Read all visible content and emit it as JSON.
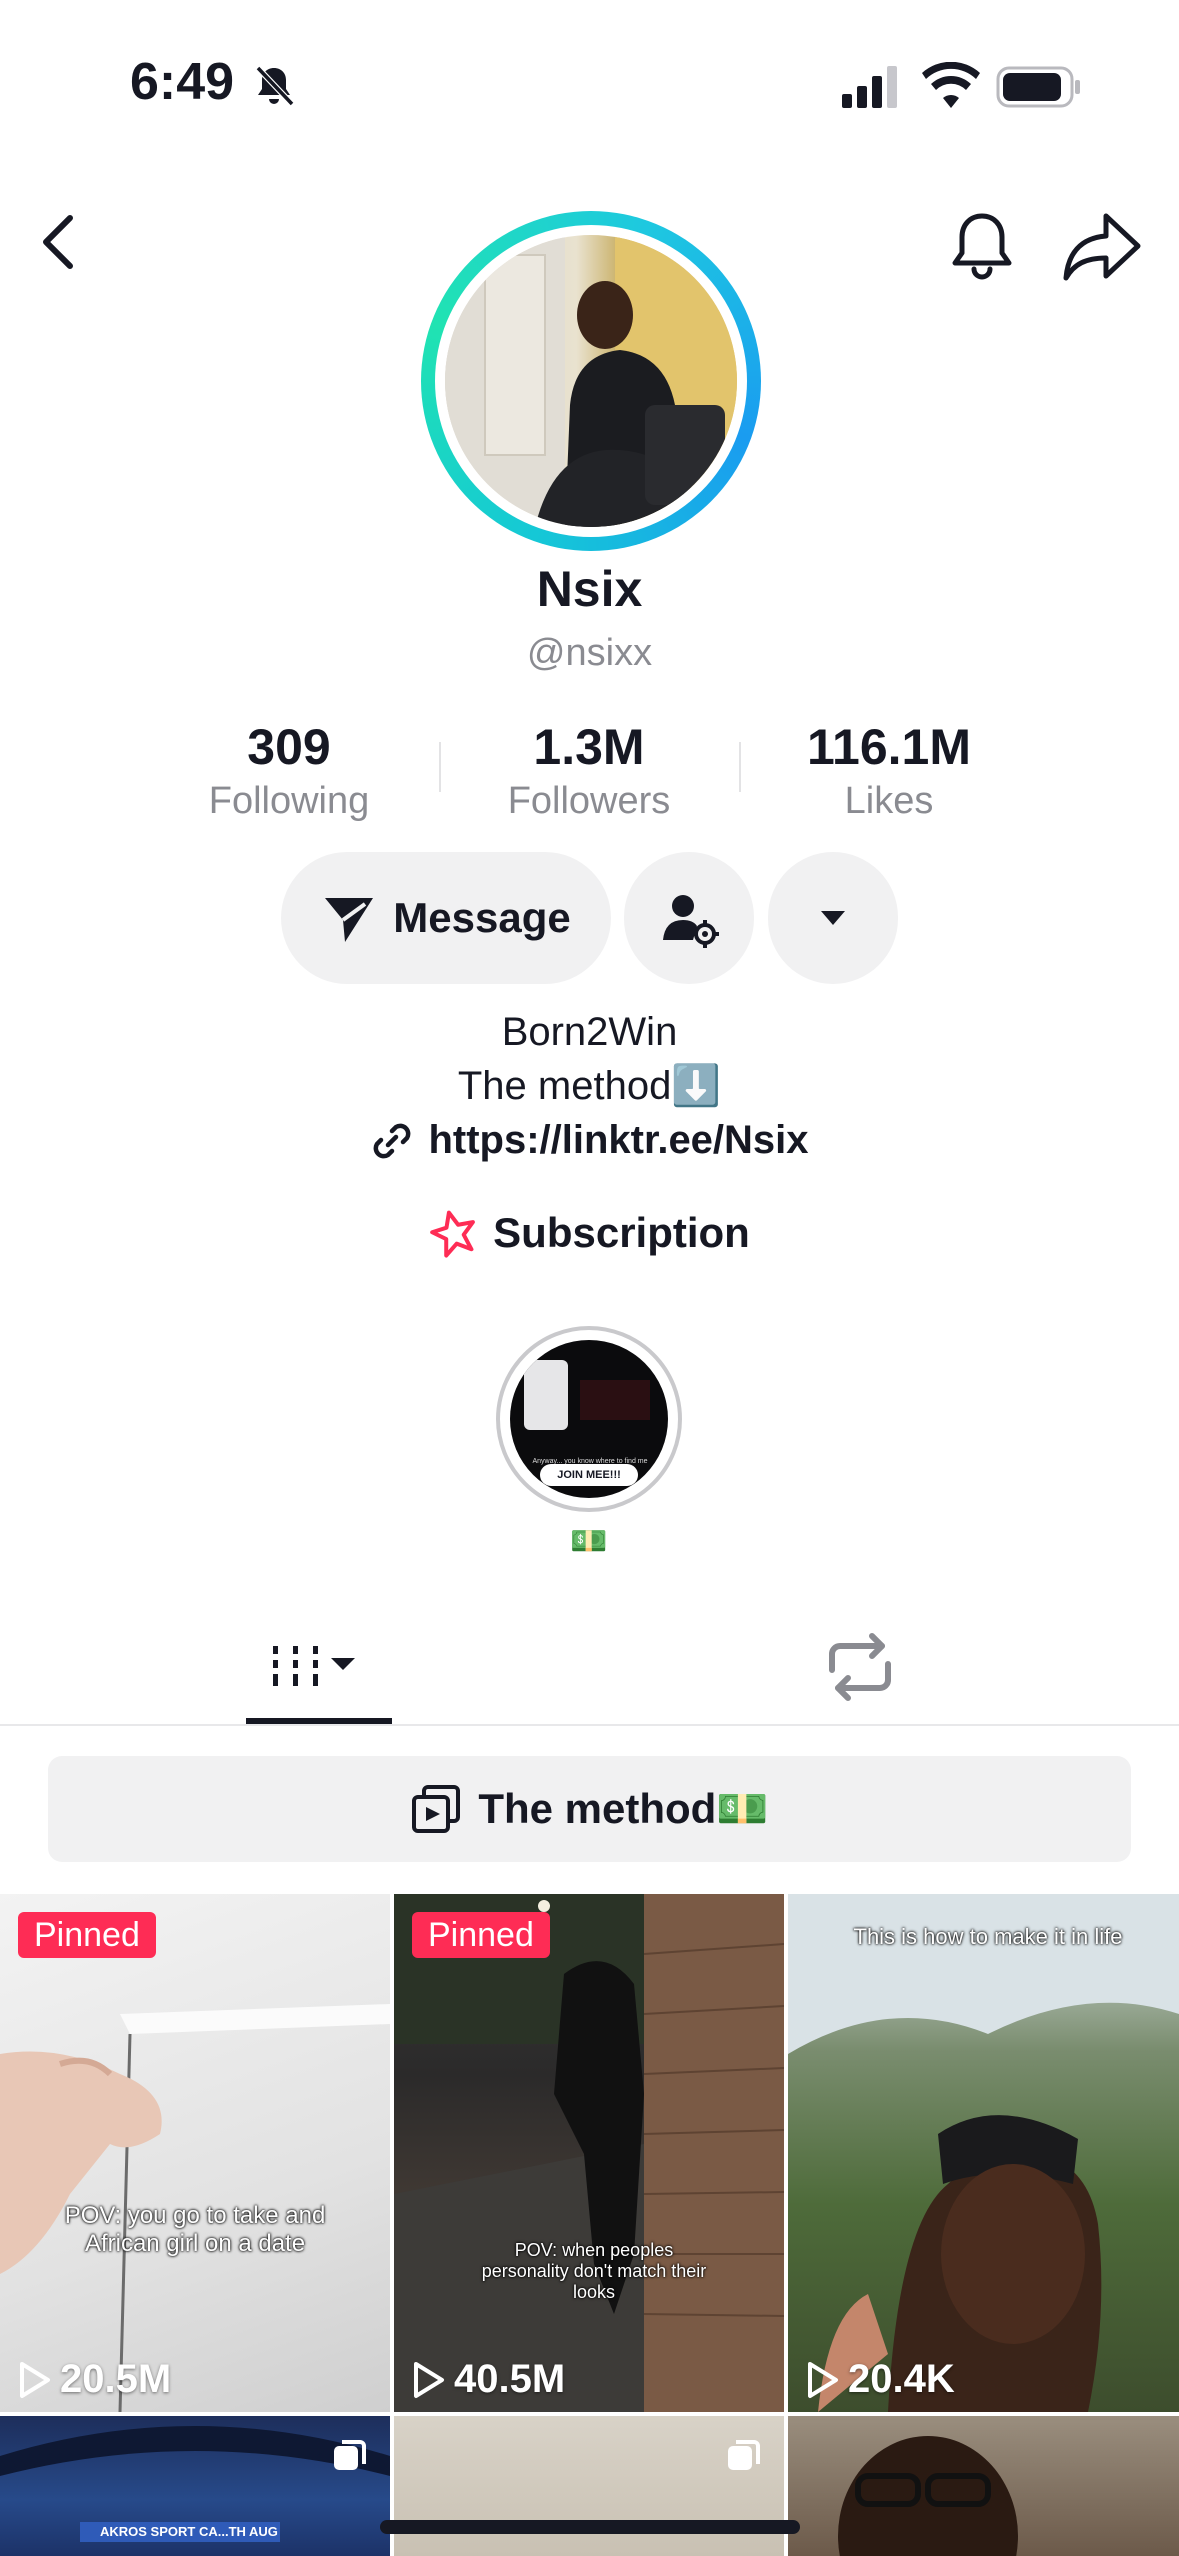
{
  "status_bar": {
    "time": "6:49"
  },
  "profile": {
    "display_name": "Nsix",
    "username": "@nsixx",
    "stats": [
      {
        "value": "309",
        "label": "Following"
      },
      {
        "value": "1.3M",
        "label": "Followers"
      },
      {
        "value": "116.1M",
        "label": "Likes"
      }
    ],
    "message_label": "Message",
    "bio_line1": "Born2Win",
    "bio_line2": "The method⬇️",
    "link": "https://linktr.ee/Nsix",
    "subscription_label": "Subscription",
    "highlight": {
      "tag": "JOIN MEE!!!",
      "caption": "Anyway... you know where to find me",
      "emoji": "💵"
    }
  },
  "playlist": {
    "label": "The method💵"
  },
  "videos": [
    {
      "pinned": "Pinned",
      "views": "20.5M",
      "caption": "POV: you go to take and African girl on a date"
    },
    {
      "pinned": "Pinned",
      "views": "40.5M",
      "caption": "POV: when peoples personality don't match their looks"
    },
    {
      "views": "20.4K",
      "caption": "This is how to make it in life"
    },
    {
      "caption": "AKROS SPORT CA...TH AUG"
    }
  ],
  "colors": {
    "accent": "#fe2c55",
    "ring_start": "#1a9cf0",
    "ring_end": "#20e3b2"
  }
}
